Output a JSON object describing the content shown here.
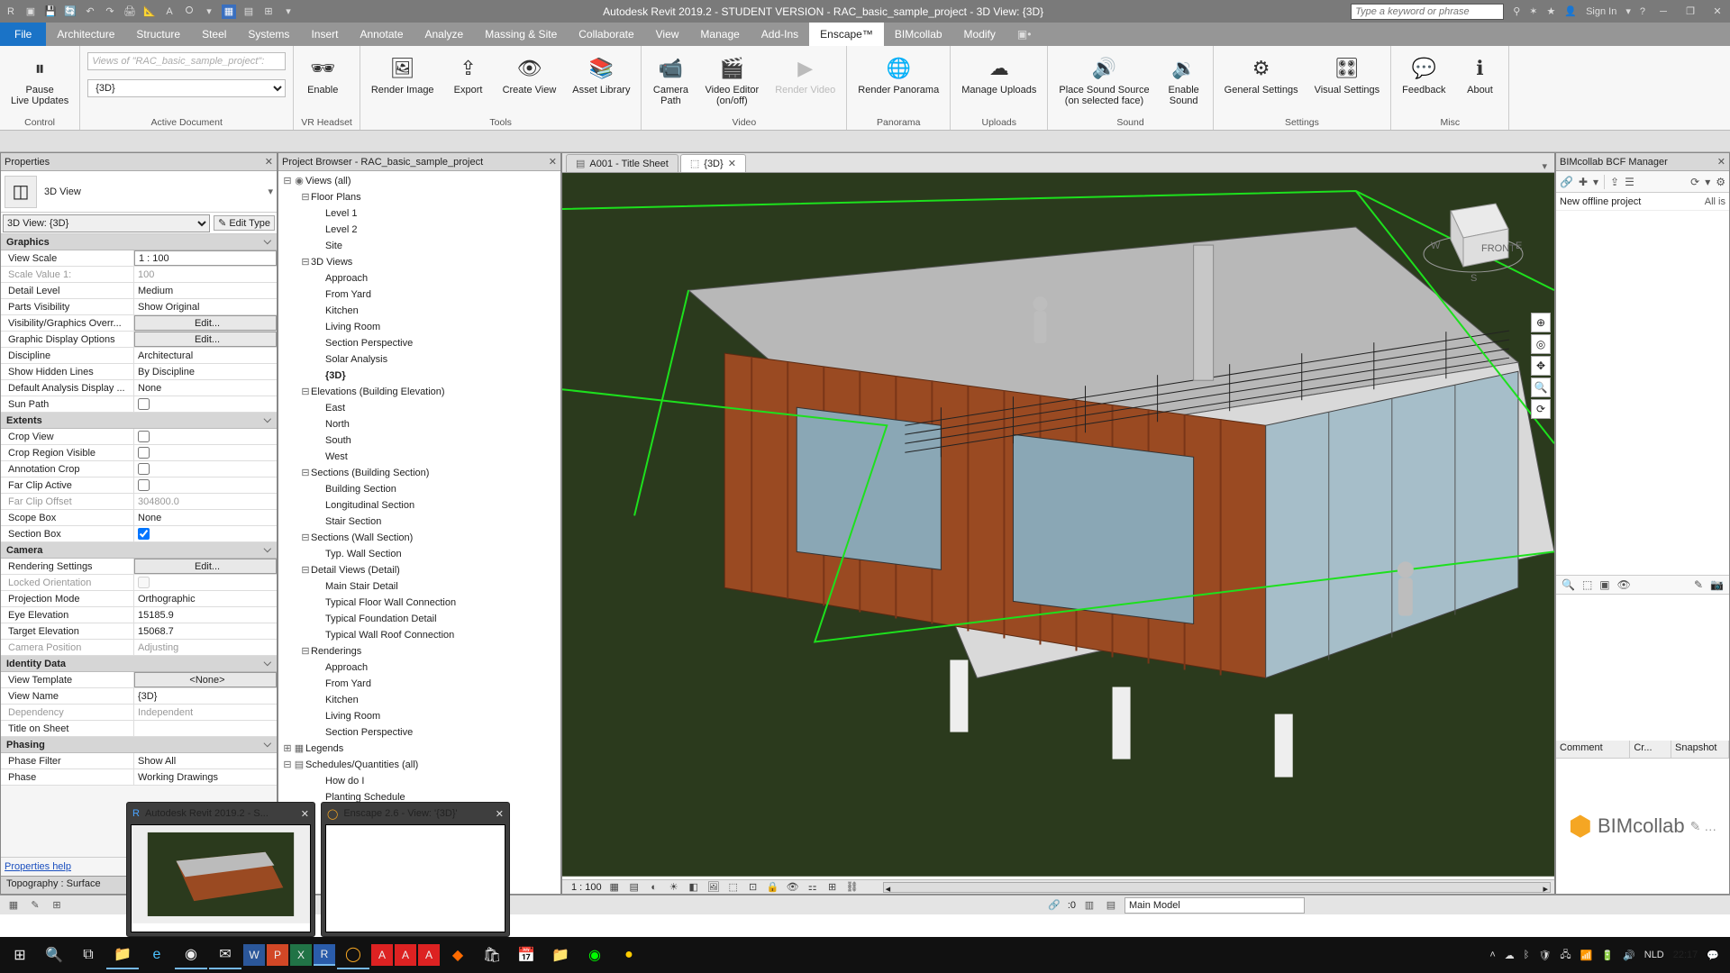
{
  "title": "Autodesk Revit 2019.2 - STUDENT VERSION - RAC_basic_sample_project - 3D View: {3D}",
  "search_placeholder": "Type a keyword or phrase",
  "signin": "Sign In",
  "menu": {
    "file": "File",
    "arch": "Architecture",
    "struct": "Structure",
    "steel": "Steel",
    "sys": "Systems",
    "insert": "Insert",
    "annotate": "Annotate",
    "analyze": "Analyze",
    "massing": "Massing & Site",
    "collab": "Collaborate",
    "view": "View",
    "manage": "Manage",
    "addins": "Add-Ins",
    "enscape": "Enscape™",
    "bimc": "BIMcollab",
    "modify": "Modify"
  },
  "ribbon": {
    "doc_hint": "Views of \"RAC_basic_sample_project\":",
    "doc_sel": "{3D}",
    "pause": "Pause\nLive Updates",
    "enable": "Enable",
    "render": "Render Image",
    "export": "Export",
    "create": "Create View",
    "asset": "Asset Library",
    "camera": "Camera\nPath",
    "vedit": "Video Editor\n(on/off)",
    "rvideo": "Render Video",
    "panorama": "Render Panorama",
    "uploads": "Manage Uploads",
    "sound": "Place Sound Source\n(on selected face)",
    "esound": "Enable\nSound",
    "gsettings": "General Settings",
    "vsettings": "Visual Settings",
    "feedback": "Feedback",
    "about": "About",
    "g_control": "Control",
    "g_doc": "Active Document",
    "g_vr": "VR Headset",
    "g_tools": "Tools",
    "g_video": "Video",
    "g_pano": "Panorama",
    "g_upl": "Uploads",
    "g_sound": "Sound",
    "g_set": "Settings",
    "g_misc": "Misc"
  },
  "props": {
    "hdr": "Properties",
    "type": "3D View",
    "sel": "3D View: {3D}",
    "edit": "Edit Type",
    "s_graphics": "Graphics",
    "view_scale_k": "View Scale",
    "view_scale_v": "1 : 100",
    "scale_val_k": "Scale Value    1:",
    "scale_val_v": "100",
    "detail_k": "Detail Level",
    "detail_v": "Medium",
    "parts_k": "Parts Visibility",
    "parts_v": "Show Original",
    "vg_k": "Visibility/Graphics Overr...",
    "edit_btn": "Edit...",
    "gd_k": "Graphic Display Options",
    "disc_k": "Discipline",
    "disc_v": "Architectural",
    "shl_k": "Show Hidden Lines",
    "shl_v": "By Discipline",
    "dad_k": "Default Analysis Display ...",
    "dad_v": "None",
    "sun_k": "Sun Path",
    "s_extents": "Extents",
    "crop_k": "Crop View",
    "cropr_k": "Crop Region Visible",
    "anno_k": "Annotation Crop",
    "fca_k": "Far Clip Active",
    "fco_k": "Far Clip Offset",
    "fco_v": "304800.0",
    "scope_k": "Scope Box",
    "scope_v": "None",
    "secbox_k": "Section Box",
    "s_camera": "Camera",
    "rs_k": "Rendering Settings",
    "lo_k": "Locked Orientation",
    "pm_k": "Projection Mode",
    "pm_v": "Orthographic",
    "ee_k": "Eye Elevation",
    "ee_v": "15185.9",
    "te_k": "Target Elevation",
    "te_v": "15068.7",
    "cp_k": "Camera Position",
    "cp_v": "Adjusting",
    "s_id": "Identity Data",
    "vt_k": "View Template",
    "vt_v": "<None>",
    "vn_k": "View Name",
    "vn_v": "{3D}",
    "dep_k": "Dependency",
    "dep_v": "Independent",
    "tos_k": "Title on Sheet",
    "s_phase": "Phasing",
    "pf_k": "Phase Filter",
    "pf_v": "Show All",
    "ph_k": "Phase",
    "ph_v": "Working Drawings",
    "help": "Properties help",
    "foot": "Topography : Surface"
  },
  "browser": {
    "hdr": "Project Browser - RAC_basic_sample_project",
    "views": "Views (all)",
    "floor": "Floor Plans",
    "l1": "Level 1",
    "l2": "Level 2",
    "site": "Site",
    "v3d": "3D Views",
    "appr": "Approach",
    "yard": "From Yard",
    "kitchen": "Kitchen",
    "living": "Living Room",
    "secp": "Section Perspective",
    "solar": "Solar Analysis",
    "cur3d": "{3D}",
    "elev": "Elevations (Building Elevation)",
    "east": "East",
    "north": "North",
    "south": "South",
    "west": "West",
    "secb": "Sections (Building Section)",
    "bsec": "Building Section",
    "lsec": "Longitudinal Section",
    "ssec": "Stair Section",
    "secw": "Sections (Wall Section)",
    "tws": "Typ. Wall Section",
    "detv": "Detail Views (Detail)",
    "msd": "Main Stair Detail",
    "tfw": "Typical Floor Wall Connection",
    "tfd": "Typical Foundation Detail",
    "twr": "Typical Wall Roof Connection",
    "rend": "Renderings",
    "leg": "Legends",
    "sched": "Schedules/Quantities (all)",
    "how": "How do I",
    "plant": "Planting Schedule"
  },
  "vtabs": {
    "t1": "A001 - Title Sheet",
    "t2": "{3D}"
  },
  "vbar": {
    "scale": "1 : 100"
  },
  "bimc": {
    "hdr": "BIMcollab BCF Manager",
    "proj": "New offline project",
    "all": "All is",
    "c1": "Comment",
    "c2": "Cr...",
    "c3": "Snapshot",
    "logo": "BIMcollab"
  },
  "status": {
    "coord": ":0",
    "model": "Main Model"
  },
  "thumbs": {
    "t1": "Autodesk Revit 2019.2 - S...",
    "t2": "Enscape 2.6 - View: '{3D}'"
  },
  "tray": {
    "lang": "NLD",
    "time": "22:17",
    "date": "    "
  }
}
